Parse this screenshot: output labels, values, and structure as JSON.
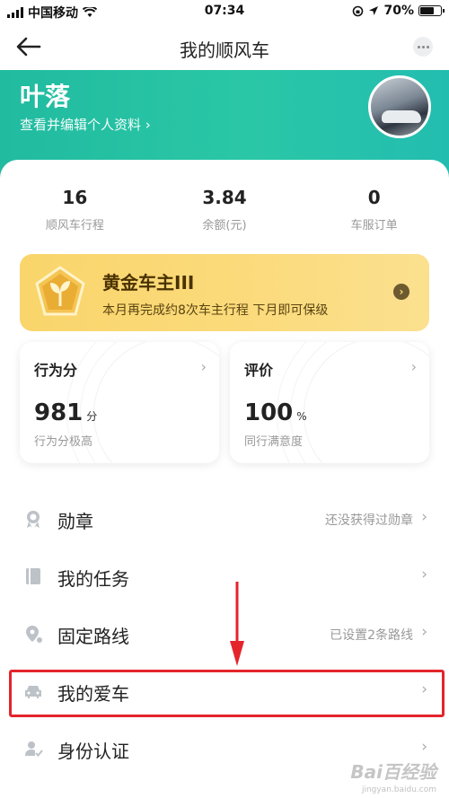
{
  "status_bar": {
    "carrier": "中国移动",
    "time": "07:34",
    "battery": "70%",
    "battery_level": 0.7,
    "icons": [
      "signal-icon",
      "wifi-icon",
      "rotation-lock-icon",
      "location-icon",
      "battery-icon"
    ]
  },
  "nav": {
    "title": "我的顺风车",
    "back_icon": "back-arrow-icon",
    "more_icon": "more-dots-icon"
  },
  "profile": {
    "name": "叶落",
    "edit_link": "查看并编辑个人资料 ›"
  },
  "stats": [
    {
      "value": "16",
      "label": "顺风车行程"
    },
    {
      "value": "3.84",
      "label": "余额(元)"
    },
    {
      "value": "0",
      "label": "车服订单"
    }
  ],
  "gold_banner": {
    "title": "黄金车主III",
    "subtitle": "本月再完成约8次车主行程 下月即可保级",
    "icon": "sprout-badge-icon"
  },
  "score_cards": [
    {
      "title": "行为分",
      "value": "981",
      "unit": "分",
      "desc": "行为分极高"
    },
    {
      "title": "评价",
      "value": "100",
      "unit": "%",
      "desc": "同行满意度"
    }
  ],
  "menu": [
    {
      "label": "勋章",
      "right": "还没获得过勋章",
      "icon": "medal-icon"
    },
    {
      "label": "我的任务",
      "right": "",
      "icon": "task-book-icon"
    },
    {
      "label": "固定路线",
      "right": "已设置2条路线",
      "icon": "route-pin-icon"
    },
    {
      "label": "我的爱车",
      "right": "",
      "icon": "car-icon"
    },
    {
      "label": "身份认证",
      "right": "",
      "icon": "id-verify-icon"
    }
  ],
  "colors": {
    "header_teal": "#21bba0",
    "gold": "#f9d56b",
    "highlight_red": "#e4242b"
  },
  "watermark": {
    "brand": "Bai百经验",
    "url": "jingyan.baidu.com"
  }
}
